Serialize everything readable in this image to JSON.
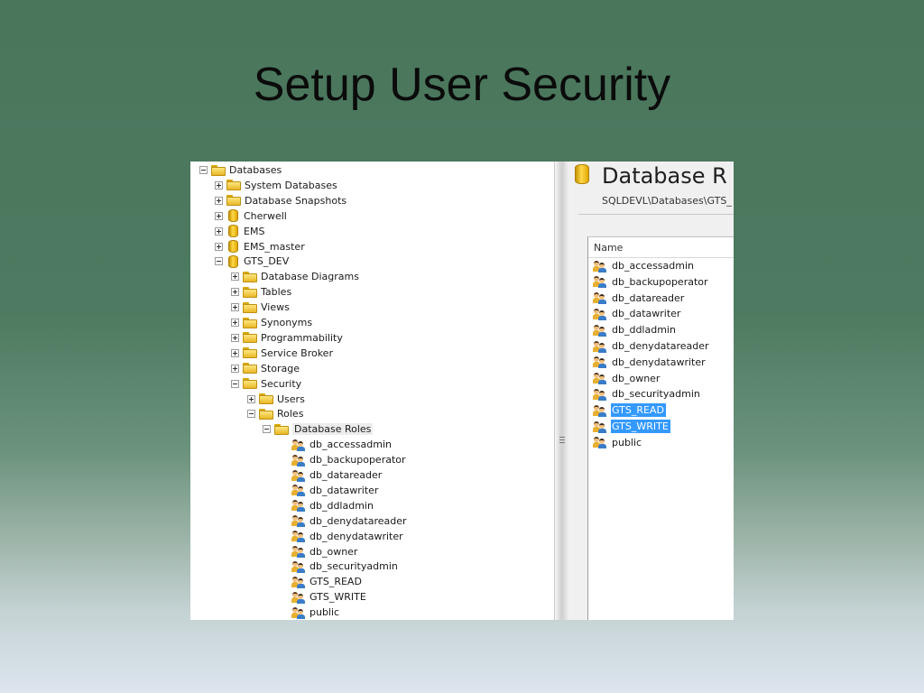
{
  "slide": {
    "title": "Setup User Security"
  },
  "tree": {
    "nodes": [
      {
        "label": "Databases",
        "icon": "folder-icon",
        "expander": "minus",
        "level": 0
      },
      {
        "label": "System Databases",
        "icon": "folder-icon",
        "expander": "plus",
        "level": 1
      },
      {
        "label": "Database Snapshots",
        "icon": "folder-icon",
        "expander": "plus",
        "level": 1
      },
      {
        "label": "Cherwell",
        "icon": "database-icon",
        "expander": "plus",
        "level": 1
      },
      {
        "label": "EMS",
        "icon": "database-icon",
        "expander": "plus",
        "level": 1
      },
      {
        "label": "EMS_master",
        "icon": "database-icon",
        "expander": "plus",
        "level": 1
      },
      {
        "label": "GTS_DEV",
        "icon": "database-icon",
        "expander": "minus",
        "level": 1
      },
      {
        "label": "Database Diagrams",
        "icon": "folder-icon",
        "expander": "plus",
        "level": 2
      },
      {
        "label": "Tables",
        "icon": "folder-icon",
        "expander": "plus",
        "level": 2
      },
      {
        "label": "Views",
        "icon": "folder-icon",
        "expander": "plus",
        "level": 2
      },
      {
        "label": "Synonyms",
        "icon": "folder-icon",
        "expander": "plus",
        "level": 2
      },
      {
        "label": "Programmability",
        "icon": "folder-icon",
        "expander": "plus",
        "level": 2
      },
      {
        "label": "Service Broker",
        "icon": "folder-icon",
        "expander": "plus",
        "level": 2
      },
      {
        "label": "Storage",
        "icon": "folder-icon",
        "expander": "plus",
        "level": 2
      },
      {
        "label": "Security",
        "icon": "folder-icon",
        "expander": "minus",
        "level": 2
      },
      {
        "label": "Users",
        "icon": "folder-icon",
        "expander": "plus",
        "level": 3
      },
      {
        "label": "Roles",
        "icon": "folder-icon",
        "expander": "minus",
        "level": 3
      },
      {
        "label": "Database Roles",
        "icon": "folder-icon",
        "expander": "minus",
        "level": 4,
        "highlighted": true
      },
      {
        "label": "db_accessadmin",
        "icon": "role-icon",
        "expander": "none",
        "level": 5
      },
      {
        "label": "db_backupoperator",
        "icon": "role-icon",
        "expander": "none",
        "level": 5
      },
      {
        "label": "db_datareader",
        "icon": "role-icon",
        "expander": "none",
        "level": 5
      },
      {
        "label": "db_datawriter",
        "icon": "role-icon",
        "expander": "none",
        "level": 5
      },
      {
        "label": "db_ddladmin",
        "icon": "role-icon",
        "expander": "none",
        "level": 5
      },
      {
        "label": "db_denydatareader",
        "icon": "role-icon",
        "expander": "none",
        "level": 5
      },
      {
        "label": "db_denydatawriter",
        "icon": "role-icon",
        "expander": "none",
        "level": 5
      },
      {
        "label": "db_owner",
        "icon": "role-icon",
        "expander": "none",
        "level": 5
      },
      {
        "label": "db_securityadmin",
        "icon": "role-icon",
        "expander": "none",
        "level": 5
      },
      {
        "label": "GTS_READ",
        "icon": "role-icon",
        "expander": "none",
        "level": 5
      },
      {
        "label": "GTS_WRITE",
        "icon": "role-icon",
        "expander": "none",
        "level": 5
      },
      {
        "label": "public",
        "icon": "role-icon",
        "expander": "none",
        "level": 5
      }
    ]
  },
  "details": {
    "title": "Database R",
    "path": "SQLDEVL\\Databases\\GTS_",
    "column_header": "Name",
    "selection_color": "#3399ff",
    "items": [
      {
        "label": "db_accessadmin",
        "selected": false
      },
      {
        "label": "db_backupoperator",
        "selected": false
      },
      {
        "label": "db_datareader",
        "selected": false
      },
      {
        "label": "db_datawriter",
        "selected": false
      },
      {
        "label": "db_ddladmin",
        "selected": false
      },
      {
        "label": "db_denydatareader",
        "selected": false
      },
      {
        "label": "db_denydatawriter",
        "selected": false
      },
      {
        "label": "db_owner",
        "selected": false
      },
      {
        "label": "db_securityadmin",
        "selected": false
      },
      {
        "label": "GTS_READ",
        "selected": true
      },
      {
        "label": "GTS_WRITE",
        "selected": true
      },
      {
        "label": "public",
        "selected": false
      }
    ]
  }
}
